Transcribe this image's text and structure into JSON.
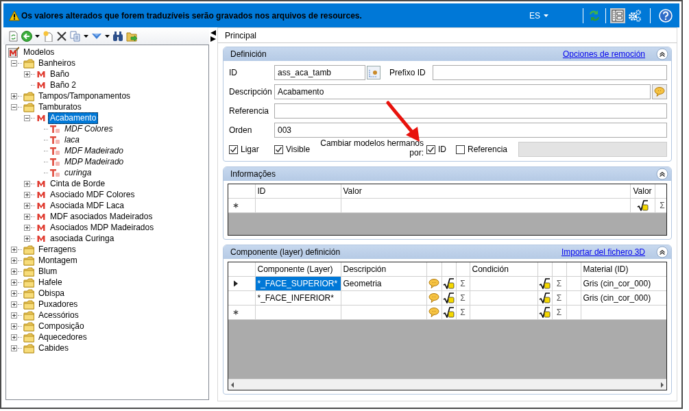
{
  "banner": {
    "message": "Os valores alterados que forem traduzíveis serão gravados nos arquivos de resources.",
    "language": "ES",
    "layout_toggle_on": true
  },
  "tree": [
    {
      "label": "Modelos",
      "kind": "root",
      "selected": false,
      "children": [
        {
          "label": "Banheiros",
          "kind": "folder",
          "expanded": true,
          "selected": false,
          "children": [
            {
              "label": "Baño",
              "kind": "model",
              "expanded": false,
              "selected": false
            },
            {
              "label": "Baño 2",
              "kind": "model",
              "selected": false
            }
          ]
        },
        {
          "label": "Tampos/Tamponamentos",
          "kind": "folder",
          "expanded": false,
          "selected": false
        },
        {
          "label": "Tamburatos",
          "kind": "folder",
          "expanded": true,
          "selected": false,
          "children": [
            {
              "label": "Acabamento",
              "kind": "model",
              "expanded": true,
              "selected": true,
              "children": [
                {
                  "label": "MDF Colores",
                  "kind": "text",
                  "selected": false
                },
                {
                  "label": "laca",
                  "kind": "text",
                  "selected": false
                },
                {
                  "label": "MDF Madeirado",
                  "kind": "text",
                  "selected": false
                },
                {
                  "label": "MDP Madeirado",
                  "kind": "text",
                  "selected": false
                },
                {
                  "label": "curinga",
                  "kind": "text",
                  "selected": false
                }
              ]
            },
            {
              "label": "Cinta de Borde",
              "kind": "model",
              "expanded": false,
              "selected": false
            },
            {
              "label": "Asociado MDF Colores",
              "kind": "model",
              "expanded": false,
              "selected": false
            },
            {
              "label": "Asociada MDF Laca",
              "kind": "model",
              "expanded": false,
              "selected": false
            },
            {
              "label": "MDF asociados Madeirados",
              "kind": "model",
              "expanded": false,
              "selected": false
            },
            {
              "label": "Asociados MDP Madeirados",
              "kind": "model",
              "expanded": false,
              "selected": false
            },
            {
              "label": "asociada Curinga",
              "kind": "model",
              "expanded": false,
              "selected": false
            }
          ]
        },
        {
          "label": "Ferragens",
          "kind": "folder",
          "expanded": false,
          "selected": false
        },
        {
          "label": "Montagem",
          "kind": "folder",
          "expanded": false,
          "selected": false
        },
        {
          "label": "Blum",
          "kind": "folder",
          "expanded": false,
          "selected": false
        },
        {
          "label": "Hafele",
          "kind": "folder",
          "expanded": false,
          "selected": false
        },
        {
          "label": "Obispa",
          "kind": "folder",
          "expanded": false,
          "selected": false
        },
        {
          "label": "Puxadores",
          "kind": "folder",
          "expanded": false,
          "selected": false
        },
        {
          "label": "Acessórios",
          "kind": "folder",
          "expanded": false,
          "selected": false
        },
        {
          "label": "Composição",
          "kind": "folder",
          "expanded": false,
          "selected": false
        },
        {
          "label": "Aquecedores",
          "kind": "folder",
          "expanded": false,
          "selected": false
        },
        {
          "label": "Cabides",
          "kind": "folder",
          "expanded": false,
          "selected": false
        }
      ]
    }
  ],
  "tab": {
    "label": "Principal"
  },
  "definition": {
    "title": "Definición",
    "link": "Opciones de remoción",
    "fields": [
      {
        "label": "ID",
        "value": "ass_aca_tamb"
      },
      {
        "label": "Prefixo ID"
      },
      {
        "label": "Descripción",
        "value": "Acabamento"
      },
      {
        "label": "Referencia"
      },
      {
        "label": "Orden",
        "value": "003"
      }
    ],
    "checkboxes": [
      {
        "label": "Ligar",
        "checked": true
      },
      {
        "label": "Visible",
        "checked": true
      }
    ],
    "siblings": {
      "label": "Cambiar modelos hermanos por:",
      "options": [
        {
          "label": "ID",
          "checked": true
        },
        {
          "label": "Referencia",
          "checked": false
        }
      ],
      "field_disabled": true
    }
  },
  "info_section": {
    "title": "Informações",
    "columns": [
      {
        "kind": "text",
        "label": "ID"
      },
      {
        "kind": "text",
        "label": "Valor"
      },
      {
        "kind": "formula",
        "label": "Valor"
      },
      {
        "kind": "sum"
      }
    ],
    "rows": [
      {
        "kind": "new",
        "selected": false,
        "cells": [
          null,
          null,
          null,
          "Σ"
        ]
      }
    ]
  },
  "components_section": {
    "title": "Componente (layer) definición",
    "link": "Importar del fichero 3D",
    "columns": [
      {
        "kind": "text",
        "label": "Componente (Layer)"
      },
      {
        "kind": "text",
        "label": "Descripción"
      },
      {
        "kind": "comment"
      },
      {
        "kind": "formula"
      },
      {
        "kind": "sum"
      },
      {
        "kind": "text",
        "label": "Condición"
      },
      {
        "kind": "formula"
      },
      {
        "kind": "sum"
      },
      {
        "kind": "blank"
      },
      {
        "kind": "text",
        "label": "Material (ID)"
      }
    ],
    "rows": [
      {
        "kind": "current",
        "selected": true,
        "cells": [
          "*_FACE_SUPERIOR*",
          "Geometria",
          null,
          null,
          "Σ",
          null,
          null,
          "Σ",
          null,
          "Gris (cin_cor_000)"
        ]
      },
      {
        "kind": "plain",
        "selected": false,
        "cells": [
          "*_FACE_INFERIOR*",
          null,
          null,
          null,
          "Σ",
          null,
          null,
          "Σ",
          null,
          "Gris (cin_cor_000)"
        ]
      },
      {
        "kind": "new",
        "selected": false,
        "cells": [
          null,
          null,
          null,
          null,
          "Σ",
          null,
          null,
          "Σ",
          null,
          null
        ]
      }
    ]
  }
}
